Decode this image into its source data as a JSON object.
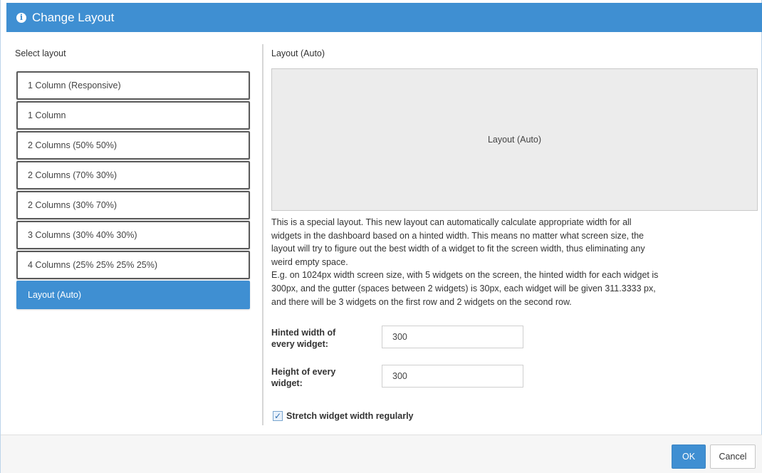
{
  "dialog": {
    "title": "Change Layout",
    "icon": "info-icon"
  },
  "left": {
    "section_label": "Select layout",
    "layouts": [
      {
        "label": "1 Column (Responsive)",
        "selected": false
      },
      {
        "label": "1 Column",
        "selected": false
      },
      {
        "label": "2 Columns (50% 50%)",
        "selected": false
      },
      {
        "label": "2 Columns (70% 30%)",
        "selected": false
      },
      {
        "label": "2 Columns (30% 70%)",
        "selected": false
      },
      {
        "label": "3 Columns (30% 40% 30%)",
        "selected": false
      },
      {
        "label": "4 Columns (25% 25% 25% 25%)",
        "selected": false
      },
      {
        "label": "Layout (Auto)",
        "selected": true
      }
    ]
  },
  "right": {
    "heading": "Layout (Auto)",
    "preview_label": "Layout (Auto)",
    "description": [
      "This is a special layout. This new layout can automatically calculate appropriate width for all",
      "widgets in the dashboard based on a hinted width. This means no matter what screen size, the",
      "layout will try to figure out the best width of a widget to fit the screen width, thus eliminating any",
      "weird empty space.",
      "E.g. on 1024px width screen size, with 5 widgets on the screen, the hinted width for each widget is",
      "300px, and the gutter (spaces between 2 widgets) is 30px, each widget will be given 311.3333 px,",
      "and there will be 3 widgets on the first row and 2 widgets on the second row."
    ],
    "hinted_width": {
      "label_line1": "Hinted width of",
      "label_line2": "every widget:",
      "value": "300"
    },
    "height": {
      "label_line1": "Height of every",
      "label_line2": "widget:",
      "value": "300"
    },
    "stretch": {
      "label": "Stretch widget width regularly",
      "checked": true
    }
  },
  "footer": {
    "ok_label": "OK",
    "cancel_label": "Cancel"
  },
  "colors": {
    "accent": "#3f8fd2",
    "preview_bg": "#ececec"
  }
}
